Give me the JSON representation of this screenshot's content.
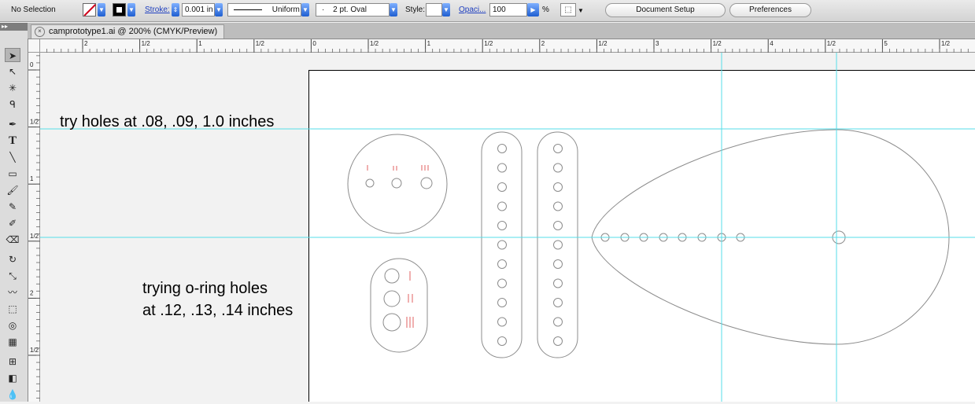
{
  "control_bar": {
    "selection_label": "No Selection",
    "stroke_label": "Stroke:",
    "stroke_weight": "0.001 in",
    "variable_width_profile": "Uniform",
    "brush": "2 pt. Oval",
    "style_label": "Style:",
    "opacity_label": "Opaci...",
    "opacity_value": "100",
    "percent": "%",
    "document_setup": "Document Setup",
    "preferences": "Preferences"
  },
  "tools_header": "▸▸",
  "document_tab": {
    "title": "camprototype1.ai @ 200% (CMYK/Preview)",
    "close": "×"
  },
  "rulers": {
    "horizontal": [
      {
        "label": "2",
        "kind": "major"
      },
      {
        "label": "1/2",
        "kind": "half"
      },
      {
        "label": "1",
        "kind": "major"
      },
      {
        "label": "1/2",
        "kind": "half"
      },
      {
        "label": "0",
        "kind": "major"
      },
      {
        "label": "1/2",
        "kind": "half"
      },
      {
        "label": "1",
        "kind": "major"
      },
      {
        "label": "1/2",
        "kind": "half"
      },
      {
        "label": "2",
        "kind": "major"
      },
      {
        "label": "1/2",
        "kind": "half"
      },
      {
        "label": "3",
        "kind": "major"
      },
      {
        "label": "1/2",
        "kind": "half"
      },
      {
        "label": "4",
        "kind": "major"
      },
      {
        "label": "1/2",
        "kind": "half"
      },
      {
        "label": "5",
        "kind": "major"
      },
      {
        "label": "1/2",
        "kind": "half"
      }
    ],
    "vertical": [
      {
        "label": "0"
      },
      {
        "label": "1/2"
      },
      {
        "label": "1"
      },
      {
        "label": "1/2"
      },
      {
        "label": "2"
      },
      {
        "label": "1/2"
      }
    ]
  },
  "canvas": {
    "note_top": "try holes at .08, .09, 1.0 inches",
    "note_bottom_line1": "trying o-ring holes",
    "note_bottom_line2": "at .12, .13, .14 inches"
  },
  "colors": {
    "guide": "#55dde8",
    "stroke": "#8c8c8c",
    "red_marks": "#e06060",
    "fill_swatch_slash": "#d0021b",
    "dropdown_blue": "#1f5fd1"
  }
}
